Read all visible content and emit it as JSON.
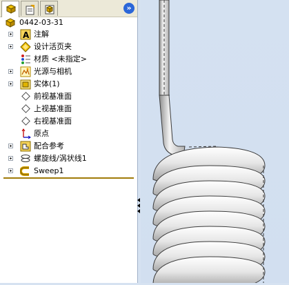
{
  "tabs": [
    {
      "name": "featuremanager"
    },
    {
      "name": "propertymanager"
    },
    {
      "name": "configurationmanager"
    }
  ],
  "expand_label": "»",
  "tree": {
    "root": "0442-03-31",
    "items": [
      {
        "label": "注解",
        "expandable": true,
        "icon": "annotations-icon"
      },
      {
        "label": "设计活页夹",
        "expandable": true,
        "icon": "design-binder-icon"
      },
      {
        "label": "材质 <未指定>",
        "expandable": false,
        "icon": "material-icon"
      },
      {
        "label": "光源与相机",
        "expandable": true,
        "icon": "lights-cameras-icon"
      },
      {
        "label": "实体(1)",
        "expandable": true,
        "icon": "solid-bodies-icon"
      },
      {
        "label": "前视基准面",
        "expandable": false,
        "icon": "plane-icon"
      },
      {
        "label": "上视基准面",
        "expandable": false,
        "icon": "plane-icon"
      },
      {
        "label": "右视基准面",
        "expandable": false,
        "icon": "plane-icon"
      },
      {
        "label": "原点",
        "expandable": false,
        "icon": "origin-icon"
      },
      {
        "label": "配合参考",
        "expandable": true,
        "icon": "mate-reference-icon"
      },
      {
        "label": "螺旋线/涡状线1",
        "expandable": true,
        "icon": "helix-icon"
      },
      {
        "label": "Sweep1",
        "expandable": true,
        "icon": "sweep-icon"
      }
    ]
  },
  "colors": {
    "viewport_bg": "#d4e1f1",
    "accent_line": "#a07a08",
    "part_icon": "#d9a400"
  }
}
